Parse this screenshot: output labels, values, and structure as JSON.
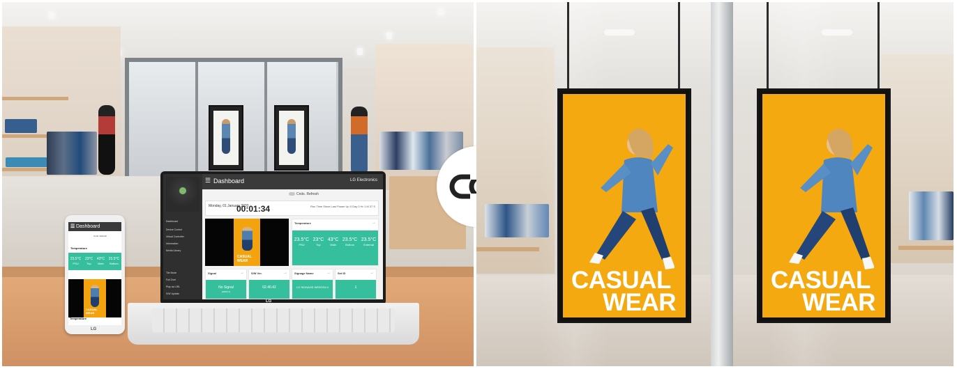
{
  "scene": {
    "phone_app_title": "Dashboard",
    "laptop_app_title": "Dashboard",
    "brand_text": "LG Electronics",
    "auto_refresh_label": "Cnds. Refresh",
    "date_text": "Monday, 01 January 2020",
    "clock_time": "00:01:34",
    "runtime_text": "Run Time Since Last Power Up 0 Day 0 Hr 1 M 37 S",
    "temperature_title": "Temperature",
    "temperature_values": [
      {
        "value": "23.5°C",
        "label": "PSU"
      },
      {
        "value": "23°C",
        "label": "Top"
      },
      {
        "value": "43°C",
        "label": "Main"
      },
      {
        "value": "23.5°C",
        "label": "Bottom"
      },
      {
        "value": "23.5°C",
        "label": "External"
      }
    ],
    "cards": [
      {
        "title": "Signal",
        "value": "No Signal",
        "detail": "[HDMI 1]"
      },
      {
        "title": "S/W Ver.",
        "value": "02.40.42"
      },
      {
        "title": "Signage Name",
        "value": "LG SIGNAGE WEBOS4.0"
      },
      {
        "title": "Set ID",
        "value": "1"
      }
    ],
    "side_menu": [
      "Dashboard",
      "Device Control",
      "Virtual Controller",
      "Information",
      "Media Library",
      "Tile Mode",
      "Fail Over",
      "Play via URL",
      "S/W Update"
    ],
    "poster_text_1": "CASUAL",
    "poster_text_2": "WEAR",
    "phone_temp_label": "Temperature",
    "laptop_logo": "LG",
    "phone_logo": "LG"
  },
  "colors": {
    "teal": "#35bf9c",
    "poster_yellow": "#f4a911",
    "dark_header": "#3a3a3a"
  }
}
